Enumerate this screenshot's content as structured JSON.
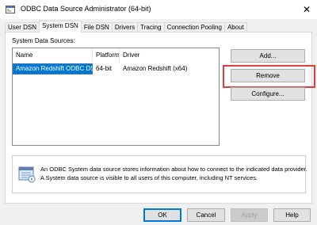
{
  "window": {
    "title": "ODBC Data Source Administrator (64-bit)",
    "close_glyph": "✕"
  },
  "tabs": [
    {
      "label": "User DSN",
      "active": false
    },
    {
      "label": "System DSN",
      "active": true
    },
    {
      "label": "File DSN",
      "active": false
    },
    {
      "label": "Drivers",
      "active": false
    },
    {
      "label": "Tracing",
      "active": false
    },
    {
      "label": "Connection Pooling",
      "active": false
    },
    {
      "label": "About",
      "active": false
    }
  ],
  "system_dsn": {
    "section_label": "System Data Sources:",
    "columns": [
      "Name",
      "Platform",
      "Driver"
    ],
    "rows": [
      {
        "name": "Amazon Redshift ODBC DSN",
        "platform": "64-bit",
        "driver": "Amazon Redshift (x64)",
        "selected": true
      }
    ]
  },
  "side_buttons": {
    "add_label": "Add...",
    "remove_label": "Remove",
    "configure_label": "Configure..."
  },
  "info": {
    "line1": "An ODBC System data source stores information about how to connect to the indicated data provider.",
    "line2": "A System data source is visible to all users of this computer, including NT services."
  },
  "footer_buttons": {
    "ok_label": "OK",
    "cancel_label": "Cancel",
    "apply_label": "Apply",
    "help_label": "Help"
  },
  "colors": {
    "selection": "#0078d7",
    "highlight_outline": "#e0403a",
    "dialog_bg": "#f0f0f0"
  },
  "icons": {
    "app": "odbc-app-icon",
    "info": "database-info-icon",
    "close": "close-icon"
  }
}
